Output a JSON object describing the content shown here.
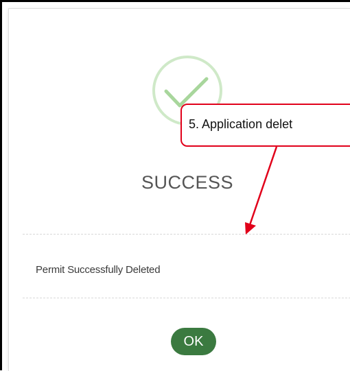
{
  "dialog": {
    "icon": "check-circle-icon",
    "title": "SUCCESS",
    "message": "Permit Successfully Deleted",
    "ok_label": "OK"
  },
  "annotation": {
    "callout_text": "5. Application delet",
    "color": "#e1001a"
  },
  "colors": {
    "success_ring": "#cfe9c8",
    "success_check": "#a8d69c",
    "button": "#3b7a40"
  }
}
